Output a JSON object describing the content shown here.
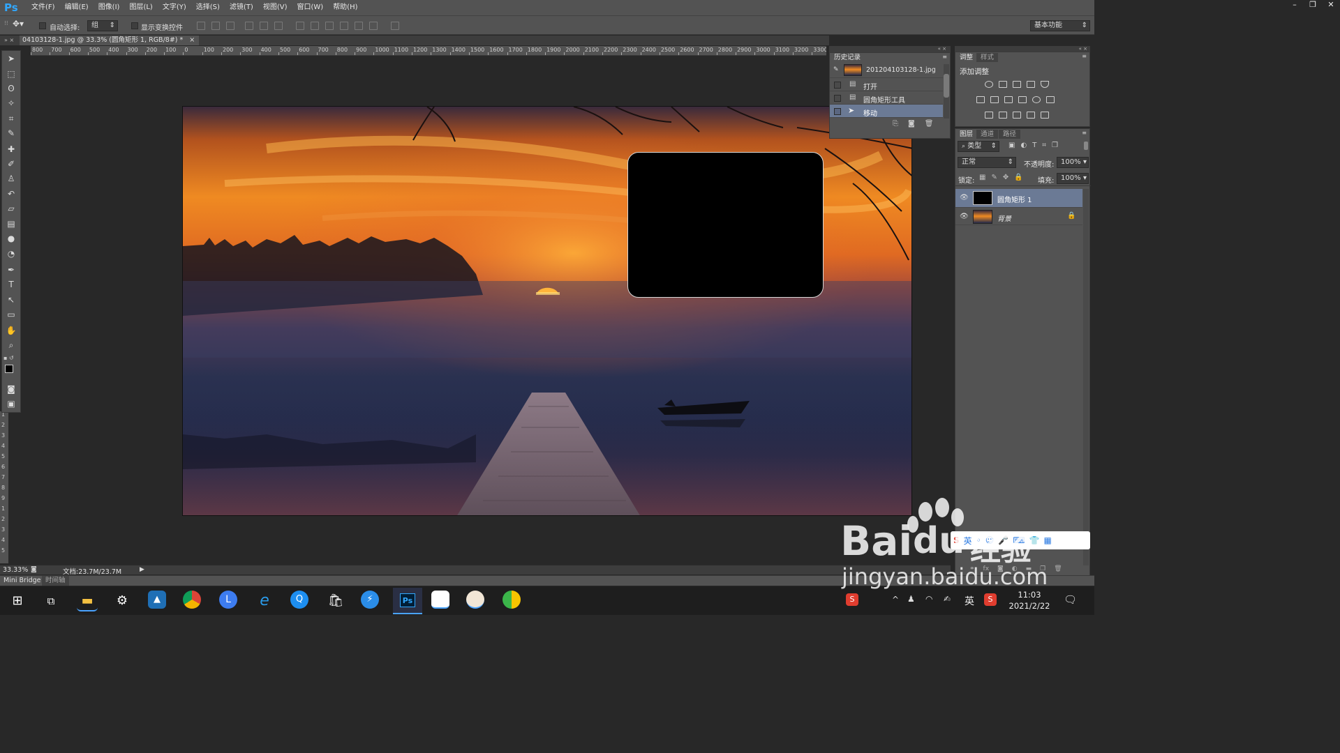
{
  "app": {
    "logo": "Ps"
  },
  "menu": [
    "文件(F)",
    "编辑(E)",
    "图像(I)",
    "图层(L)",
    "文字(Y)",
    "选择(S)",
    "滤镜(T)",
    "视图(V)",
    "窗口(W)",
    "帮助(H)"
  ],
  "window_controls": [
    "–",
    "❐",
    "✕"
  ],
  "options": {
    "auto_select_label": "自动选择:",
    "auto_select_value": "组",
    "transform_label": "显示变换控件",
    "workspace": "基本功能"
  },
  "document_tab": {
    "title": "04103128-1.jpg @ 33.3% (圆角矩形 1, RGB/8#) *",
    "close": "×"
  },
  "ruler_h": [
    "800",
    "700",
    "600",
    "500",
    "400",
    "300",
    "200",
    "100",
    "0",
    "100",
    "200",
    "300",
    "400",
    "500",
    "600",
    "700",
    "800",
    "900",
    "1000",
    "1100",
    "1200",
    "1300",
    "1400",
    "1500",
    "1600",
    "1700",
    "1800",
    "1900",
    "2000",
    "2100",
    "2200",
    "2300",
    "2400",
    "2500",
    "2600",
    "2700",
    "2800",
    "2900",
    "3000",
    "3100",
    "3200",
    "3300"
  ],
  "ruler_v": [
    "1",
    "2",
    "3",
    "4",
    "5",
    "6",
    "7",
    "8",
    "9",
    "1",
    "2",
    "3",
    "4",
    "5"
  ],
  "history": {
    "tab": "历史记录",
    "snapshot": "201204103128-1.jpg",
    "items": [
      "打开",
      "圆角矩形工具",
      "移动"
    ],
    "selected_index": 2
  },
  "adjustments": {
    "tabs": [
      "调整",
      "样式"
    ],
    "title": "添加调整"
  },
  "layers": {
    "tabs": [
      "图层",
      "通道",
      "路径"
    ],
    "filter": "类型",
    "blend_mode": "正常",
    "opacity_label": "不透明度:",
    "opacity": "100%",
    "lock_label": "锁定:",
    "fill_label": "填充:",
    "fill": "100%",
    "items": [
      {
        "name": "圆角矩形 1",
        "selected": true
      },
      {
        "name": "背景",
        "selected": false,
        "locked": true
      }
    ]
  },
  "status": {
    "zoom": "33.33%",
    "doc": "文档:23.7M/23.7M"
  },
  "bottom_tabs": [
    "Mini Bridge",
    "时间轴"
  ],
  "taskbar": {
    "apps": [
      "start-icon",
      "task-view-icon",
      "file-explorer-icon",
      "settings-icon",
      "photos-icon",
      "chrome-icon",
      "l-app-icon",
      "ie-icon",
      "browser-q-icon",
      "store-icon",
      "sogou-icon",
      "photoshop-icon",
      "baidu-netdisk-icon",
      "game-icon",
      "360-icon"
    ],
    "ime": "英",
    "time": "11:03",
    "date": "2021/2/22"
  },
  "watermark": {
    "text_top": "Bai",
    "text_mid": "经验",
    "url": "jingyan.baidu.com"
  },
  "colors": {
    "panel": "#535353",
    "dark": "#282828",
    "accent": "#31a8ff"
  }
}
